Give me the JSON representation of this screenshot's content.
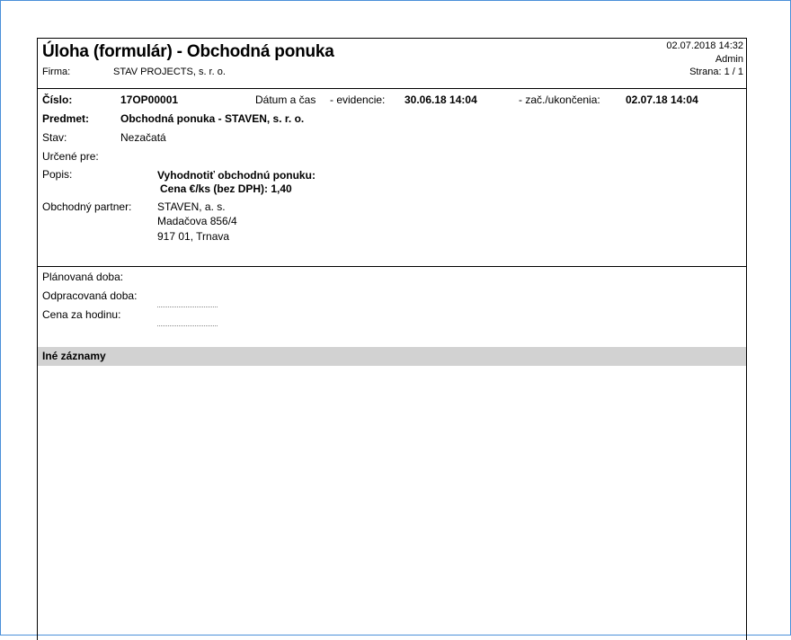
{
  "header": {
    "title": "Úloha (formulár) - Obchodná ponuka",
    "company_label": "Firma:",
    "company_value": "STAV PROJECTS, s. r. o.",
    "datetime": "02.07.2018 14:32",
    "user": "Admin",
    "page": "Strana: 1 / 1"
  },
  "details": {
    "number_label": "Číslo:",
    "number_value": "17OP00001",
    "datetime_label": "Dátum a čas",
    "evidence_label": "- evidencie:",
    "evidence_value": "30.06.18  14:04",
    "start_end_label": "- zač./ukončenia:",
    "start_end_value": "02.07.18  14:04",
    "subject_label": "Predmet:",
    "subject_value": "Obchodná ponuka - STAVEN, s. r. o.",
    "status_label": "Stav:",
    "status_value": "Nezačatá",
    "assigned_label": "Určené pre:",
    "assigned_value": "",
    "description_label": "Popis:",
    "description_line1": "Vyhodnotiť obchodnú ponuku:",
    "description_line2": "Cena €/ks (bez DPH): 1,40",
    "partner_label": "Obchodný partner:",
    "partner_line1": "STAVEN, a. s.",
    "partner_line2": "Madačova 856/4",
    "partner_line3": "917 01, Trnava"
  },
  "time": {
    "planned_label": "Plánovaná doba:",
    "worked_label": "Odpracovaná doba:",
    "rate_label": "Cena za hodinu:"
  },
  "other": {
    "section_title": "Iné záznamy"
  }
}
